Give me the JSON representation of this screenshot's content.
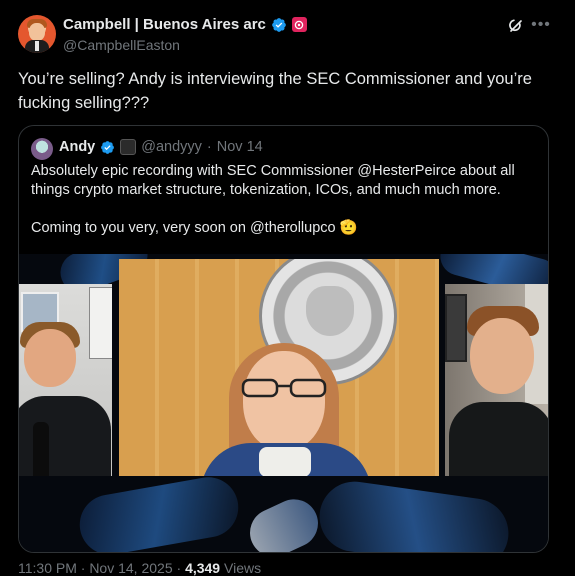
{
  "author": {
    "display_name": "Campbell | Buenos Aires arc",
    "handle": "@CampbellEaston"
  },
  "tweet": {
    "text": "You’re selling? Andy is interviewing the SEC Commissioner and you’re fucking selling???"
  },
  "quote": {
    "name": "Andy",
    "handle": "@andyyy",
    "separator": "·",
    "date": "Nov 14",
    "paragraph1": "Absolutely epic recording with SEC Commissioner @HesterPeirce about all things crypto market structure, tokenization, ICOs, and much much more.",
    "paragraph2": "Coming to you very, very soon on @therollupco 🫡"
  },
  "footer": {
    "time": "11:30 PM · Nov 14, 2025 ·",
    "views_count": "4,349",
    "views_label": "Views"
  },
  "icons": {
    "verified": "verified-badge-icon",
    "affiliate": "affiliate-badge-icon",
    "grok": "grok-icon",
    "more": "more-options-icon"
  },
  "colors": {
    "verified_blue": "#1d9bf0",
    "affiliate_red": "#e0245e",
    "muted_text": "#71767b"
  }
}
